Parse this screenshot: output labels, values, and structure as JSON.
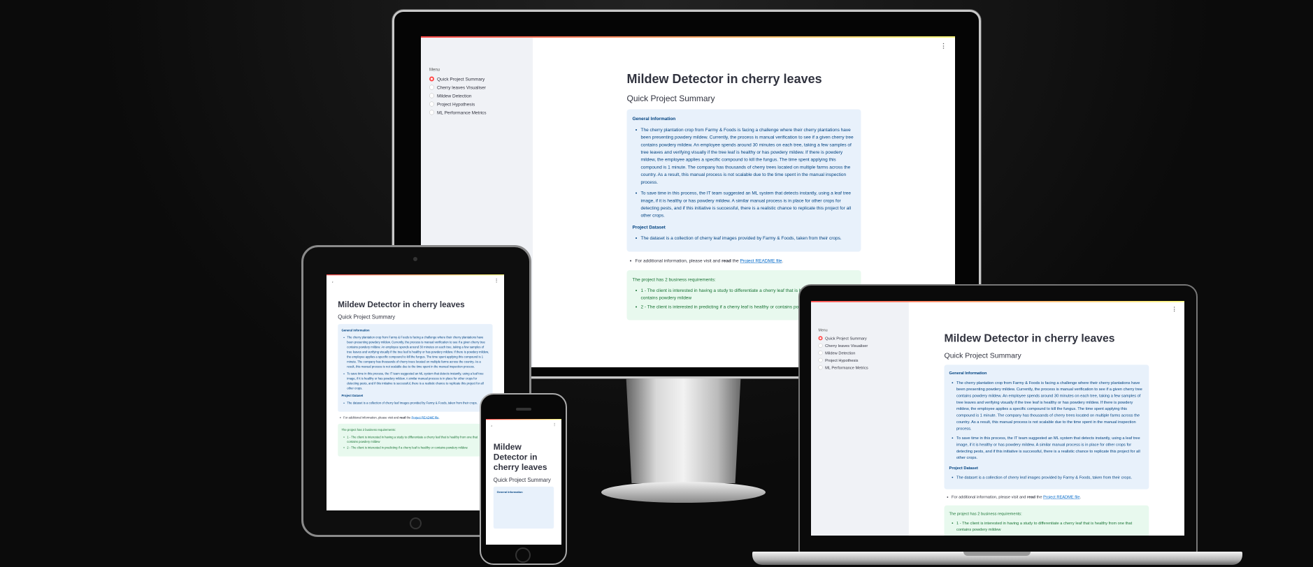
{
  "app": {
    "title": "Mildew Detector in cherry leaves",
    "subtitle": "Quick Project Summary",
    "menu_label": "Menu",
    "menu_items": [
      "Quick Project Summary",
      "Cherry leaves Visualiser",
      "Mildew Detection",
      "Project Hypothesis",
      "ML Performance Metrics"
    ],
    "selected_menu": "Quick Project Summary",
    "kebab_icon": "⋮",
    "chevron_icon": "›",
    "info": {
      "general_heading": "General Information",
      "general_bullets": [
        "The cherry plantation crop from Farmy & Foods is facing a challenge where their cherry plantations have been presenting powdery mildew. Currently, the process is manual verification to see if a given cherry tree contains powdery mildew. An employee spends around 30 minutes on each tree, taking a few samples of tree leaves and verifying visually if the tree leaf is healthy or has powdery mildew. If there is powdery mildew, the employee applies a specific compound to kill the fungus. The time spent applying this compound is 1 minute. The company has thousands of cherry trees located on multiple farms across the country. As a result, this manual process is not scalable due to the time spent in the manual inspection process.",
        "To save time in this process, the IT team suggested an ML system that detects instantly, using a leaf tree image, if it is healthy or has powdery mildew. A similar manual process is in place for other crops for detecting pests, and if this initiative is successful, there is a realistic chance to replicate this project for all other crops."
      ],
      "dataset_heading": "Project Dataset",
      "dataset_bullet": "The dataset is a collection of cherry leaf images provided by Farmy & Foods, taken from their crops."
    },
    "additional": {
      "prefix": "For additional information, please visit and ",
      "bold": "read",
      "middle": " the ",
      "link": "Project README file",
      "suffix": "."
    },
    "requirements": {
      "intro": "The project has 2 business requirements:",
      "items": [
        "1 - The client is interested in having a study to differentiate a cherry leaf that is healthy from one that contains powdery mildew",
        "2 - The client is interested in predicting if a cherry leaf is healthy or contains powdery mildew."
      ]
    }
  },
  "colors": {
    "accent": "#ff4b4b",
    "info_bg": "#e8f1fb",
    "info_text": "#004280",
    "success_bg": "#e8f9ee",
    "success_text": "#177233",
    "link": "#0068c9"
  }
}
